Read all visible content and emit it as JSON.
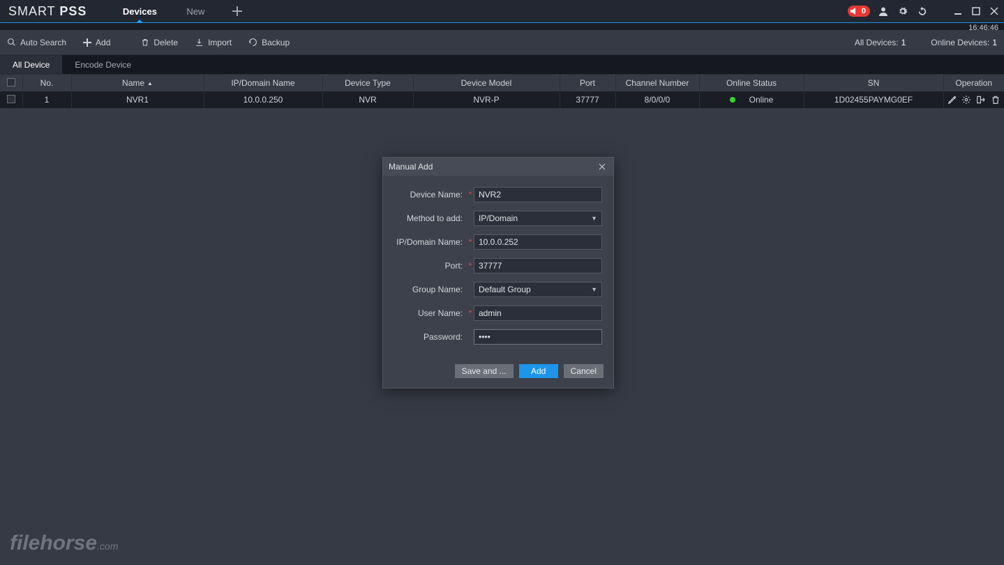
{
  "title": {
    "brand1": "SMART",
    "brand2": "PSS"
  },
  "tabs": {
    "devices": "Devices",
    "new": "New"
  },
  "badge_count": "0",
  "clock": "16:46:46",
  "toolbar": {
    "auto_search": "Auto Search",
    "add": "Add",
    "delete": "Delete",
    "import": "Import",
    "backup": "Backup",
    "all_devices_label": "All Devices:",
    "all_devices_count": "1",
    "online_devices_label": "Online Devices:",
    "online_devices_count": "1"
  },
  "subtabs": {
    "all_device": "All Device",
    "encode_device": "Encode Device"
  },
  "columns": {
    "no": "No.",
    "name": "Name",
    "ip": "IP/Domain Name",
    "type": "Device Type",
    "model": "Device Model",
    "port": "Port",
    "channel": "Channel Number",
    "status": "Online Status",
    "sn": "SN",
    "operation": "Operation"
  },
  "rows": [
    {
      "no": "1",
      "name": "NVR1",
      "ip": "10.0.0.250",
      "type": "NVR",
      "model": "NVR-P",
      "port": "37777",
      "channel": "8/0/0/0",
      "status": "Online",
      "sn": "1D02455PAYMG0EF"
    }
  ],
  "dialog": {
    "title": "Manual Add",
    "device_name_label": "Device Name:",
    "device_name_value": "NVR2",
    "method_label": "Method to add:",
    "method_value": "IP/Domain",
    "ip_label": "IP/Domain Name:",
    "ip_value": "10.0.0.252",
    "port_label": "Port:",
    "port_value": "37777",
    "group_label": "Group Name:",
    "group_value": "Default Group",
    "user_label": "User Name:",
    "user_value": "admin",
    "password_label": "Password:",
    "password_value": "••••",
    "btn_save": "Save and ...",
    "btn_add": "Add",
    "btn_cancel": "Cancel"
  },
  "watermark": {
    "main": "filehorse",
    "suffix": ".com"
  }
}
